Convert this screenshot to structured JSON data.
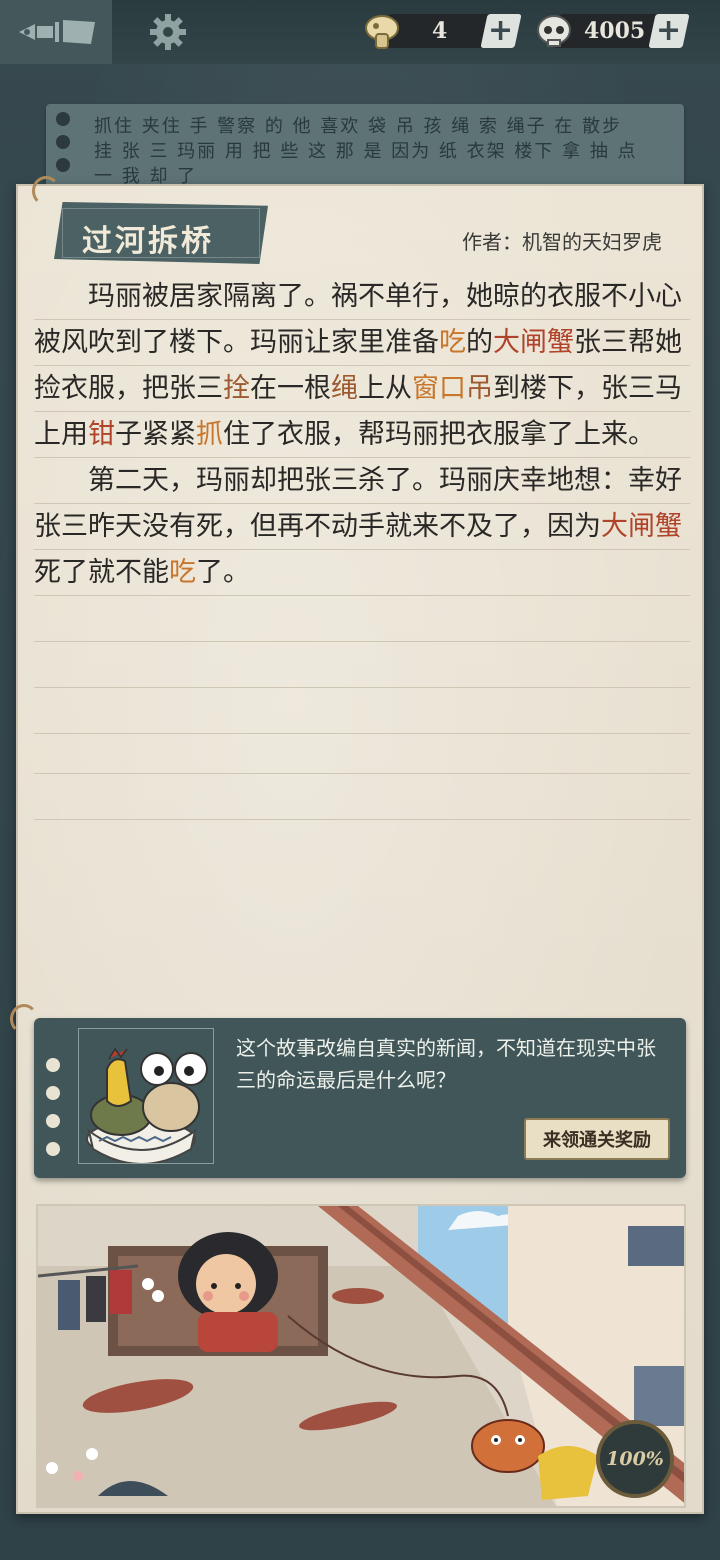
{
  "topbar": {
    "currency1": {
      "icon": "mushroom-coin-icon",
      "value": "4"
    },
    "currency2": {
      "icon": "skull-coin-icon",
      "value": "4005"
    },
    "plus_label": "+"
  },
  "background_note": {
    "text": "抓住 夹住 手 警察 的 他 喜欢 袋 吊 孩 绳 索 绳子 在 散步 挂 张 三 玛丽 用 把 些 这 那 是 因为 纸 衣架 楼下 拿 抽 点 一 我 却 了"
  },
  "story": {
    "title": "过河拆桥",
    "author": "作者：机智的天妇罗虎",
    "p1": [
      {
        "t": "玛丽被居家隔离了。祸不单行，她晾的衣服不小心被风吹到了楼下。玛丽让家里准备",
        "c": ""
      },
      {
        "t": "吃",
        "c": "hl-orange"
      },
      {
        "t": "的",
        "c": ""
      },
      {
        "t": "大闸蟹",
        "c": "hl-red"
      },
      {
        "t": "张三帮她捡衣服，把张三",
        "c": ""
      },
      {
        "t": "拴",
        "c": "hl-brown"
      },
      {
        "t": "在一根",
        "c": ""
      },
      {
        "t": "绳",
        "c": "hl-brown"
      },
      {
        "t": "上从",
        "c": ""
      },
      {
        "t": "窗口",
        "c": "hl-orange"
      },
      {
        "t": "吊",
        "c": "hl-brown"
      },
      {
        "t": "到楼下，张三马上用",
        "c": ""
      },
      {
        "t": "钳",
        "c": "hl-red"
      },
      {
        "t": "子紧紧",
        "c": ""
      },
      {
        "t": "抓",
        "c": "hl-orange"
      },
      {
        "t": "住了衣服，帮玛丽把衣服拿了上来。",
        "c": ""
      }
    ],
    "p2": [
      {
        "t": "第二天，玛丽却把张三杀了。玛丽庆幸地想：幸好张三昨天没有死，但再不动手就来不及了，因为",
        "c": ""
      },
      {
        "t": "大闸蟹",
        "c": "hl-red"
      },
      {
        "t": "死了就不能",
        "c": ""
      },
      {
        "t": "吃",
        "c": "hl-orange"
      },
      {
        "t": "了。",
        "c": ""
      }
    ]
  },
  "question": {
    "text": "这个故事改编自真实的新闻，不知道在现实中张三的命运最后是什么呢？",
    "reward_button": "来领通关奖励"
  },
  "illustration": {
    "progress": "100%"
  },
  "colors": {
    "highlight_orange": "#c8762c",
    "highlight_red": "#b0442a",
    "highlight_brown": "#9c5a30"
  }
}
